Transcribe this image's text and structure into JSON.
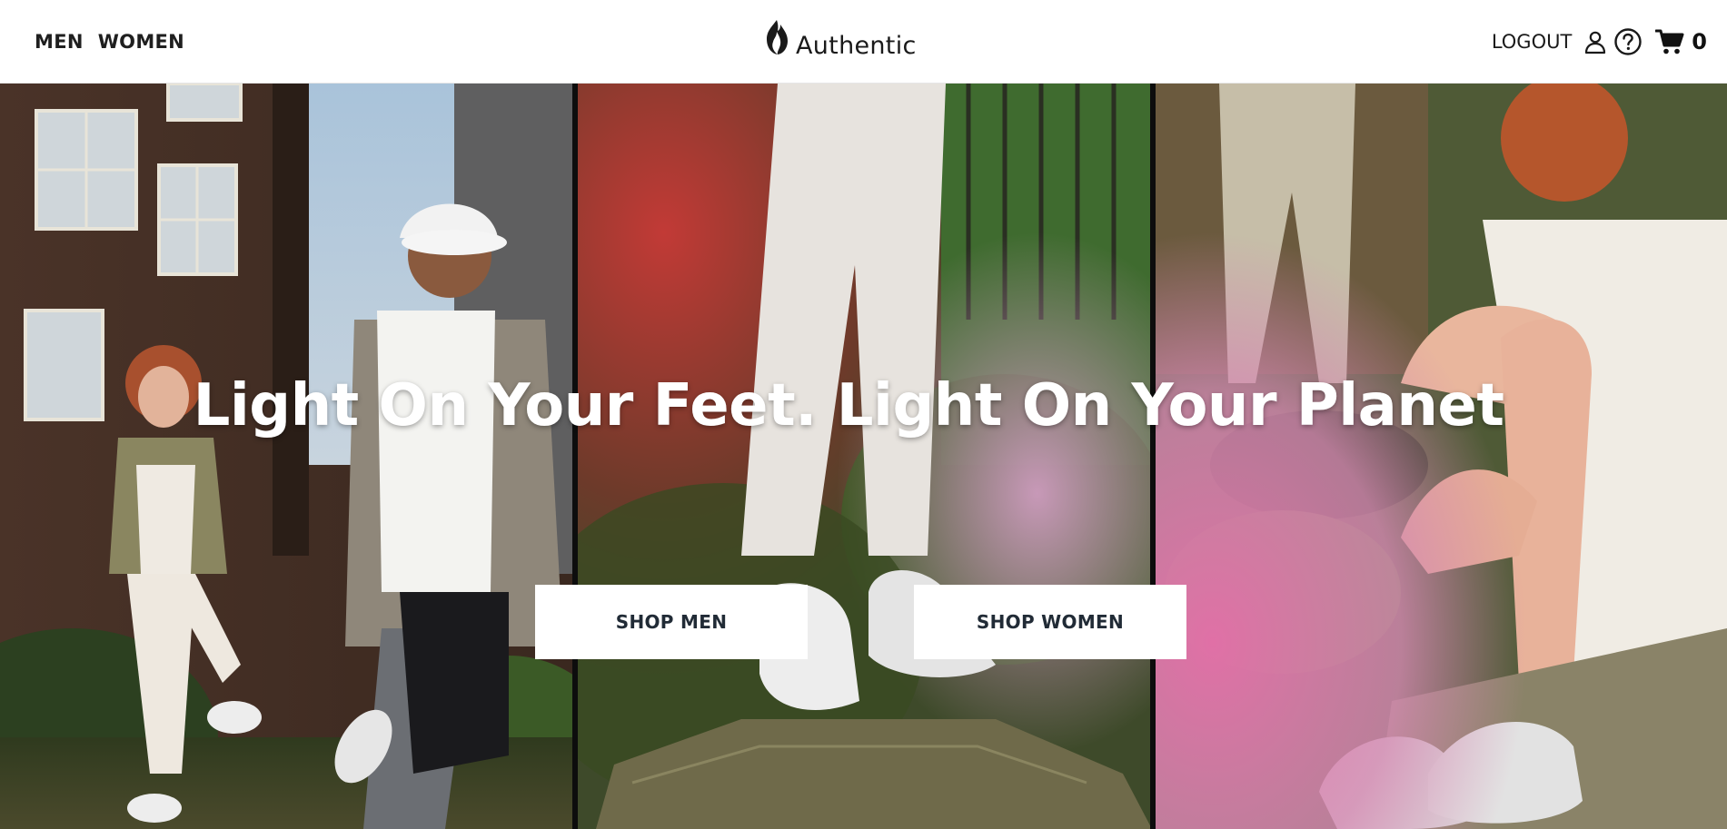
{
  "nav": {
    "men_label": "MEN",
    "women_label": "WOMEN"
  },
  "brand": {
    "name": "Authentic",
    "logo_icon": "flame-icon"
  },
  "account": {
    "logout_label": "LOGOUT",
    "user_icon": "user-icon",
    "help_icon": "help-circle-icon",
    "cart_icon": "cart-icon",
    "cart_count": "0"
  },
  "hero": {
    "headline": "Light On Your Feet. Light On Your Planet",
    "shop_men_label": "SHOP MEN",
    "shop_women_label": "SHOP WOMEN",
    "panels": [
      "photo-couple-street",
      "photo-sneakers-garden",
      "photo-seated-woman-pink"
    ]
  },
  "colors": {
    "header_bg": "#ffffff",
    "button_bg": "#ffffff",
    "button_text": "#212b36",
    "headline_text": "#ffffff"
  }
}
